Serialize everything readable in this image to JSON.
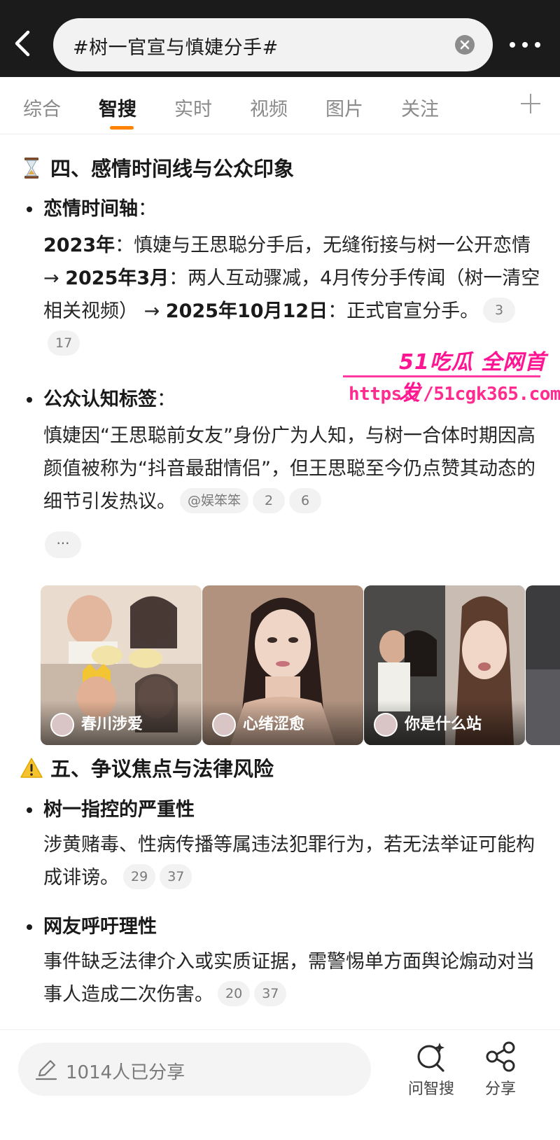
{
  "header": {
    "query": "#树一官宣与慎婕分手#"
  },
  "tabs": [
    {
      "label": "综合"
    },
    {
      "label": "智搜"
    },
    {
      "label": "实时"
    },
    {
      "label": "视频"
    },
    {
      "label": "图片"
    },
    {
      "label": "关注"
    }
  ],
  "section4": {
    "title": "四、感情时间线与公众印象",
    "item1": {
      "head": "恋情时间轴",
      "colon": "：",
      "y1": "2023年",
      "t1": "：慎婕与王思聪分手后，无缝衔接与树一公开恋情 → ",
      "y2": "2025年3月",
      "t2": "：两人互动骤减，4月传分手传闻（树一清空相关视频） → ",
      "y3": "2025年10月12日",
      "t3": "：正式官宣分手。",
      "refs": [
        "3",
        "17"
      ]
    },
    "item2": {
      "head": "公众认知标签",
      "colon": "：",
      "text": "慎婕因“王思聪前女友”身份广为人知，与树一合体时期因高颜值被称为“抖音最甜情侣”，但王思聪至今仍点赞其动态的细节引发热议。",
      "refs": [
        "@娱笨笨",
        "2",
        "6"
      ],
      "more": "···"
    }
  },
  "watermark": {
    "logo": "51吃瓜 全网首发",
    "url": "https://51cgk365.com"
  },
  "images": [
    {
      "caption": "春川涉爱"
    },
    {
      "caption": "心绪涩愈"
    },
    {
      "caption": "你是什么站"
    }
  ],
  "section5": {
    "title": "五、争议焦点与法律风险",
    "item1": {
      "head": "树一指控的严重性",
      "text": "涉黄赌毒、性病传播等属违法犯罪行为，若无法举证可能构成诽谤。",
      "refs": [
        "29",
        "37"
      ]
    },
    "item2": {
      "head": "网友呼吁理性",
      "text": "事件缺乏法律介入或实质证据，需警惕单方面舆论煽动对当事人造成二次伤害。",
      "refs": [
        "20",
        "37"
      ]
    }
  },
  "bottom": {
    "share_placeholder": "1014人已分享",
    "ask_label": "问智搜",
    "share_label": "分享"
  },
  "colors": {
    "accent": "#ff8200",
    "watermark": "#ff1493",
    "header_bg": "#1b1b1b"
  }
}
